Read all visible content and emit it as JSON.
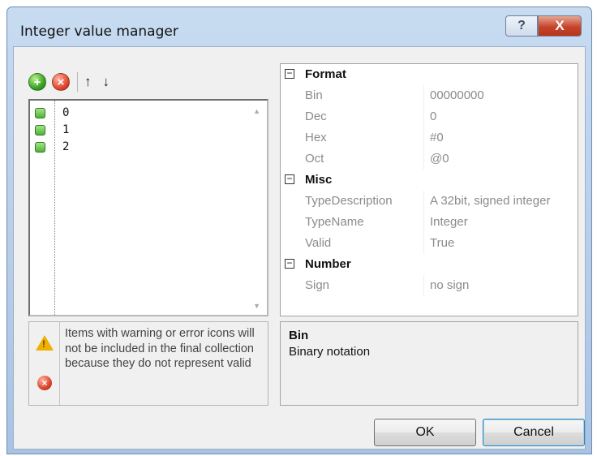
{
  "window": {
    "title": "Integer value manager",
    "help_glyph": "?",
    "close_glyph": "X"
  },
  "toolbar": {
    "add_icon": "add-icon",
    "remove_icon": "remove-icon",
    "move_up_glyph": "↑",
    "move_down_glyph": "↓"
  },
  "list": {
    "items": [
      {
        "label": "0"
      },
      {
        "label": "1"
      },
      {
        "label": "2"
      }
    ]
  },
  "warning": {
    "text": "Items with warning or error icons will not be included in the final collection because they do not represent valid"
  },
  "properties": {
    "categories": [
      {
        "name": "Format",
        "expander": "−",
        "props": [
          {
            "name": "Bin",
            "value": "00000000"
          },
          {
            "name": "Dec",
            "value": "0"
          },
          {
            "name": "Hex",
            "value": "#0"
          },
          {
            "name": "Oct",
            "value": "@0"
          }
        ]
      },
      {
        "name": "Misc",
        "expander": "−",
        "props": [
          {
            "name": "TypeDescription",
            "value": "A 32bit, signed integer"
          },
          {
            "name": "TypeName",
            "value": "Integer"
          },
          {
            "name": "Valid",
            "value": "True"
          }
        ]
      },
      {
        "name": "Number",
        "expander": "−",
        "props": [
          {
            "name": "Sign",
            "value": "no sign"
          }
        ]
      }
    ]
  },
  "description": {
    "title": "Bin",
    "text": "Binary notation"
  },
  "buttons": {
    "ok": "OK",
    "cancel": "Cancel"
  },
  "colors": {
    "accent": "#3c7fb1",
    "add_green": "#3aa326",
    "remove_red": "#e24a2e",
    "warning_yellow": "#f0b000"
  }
}
